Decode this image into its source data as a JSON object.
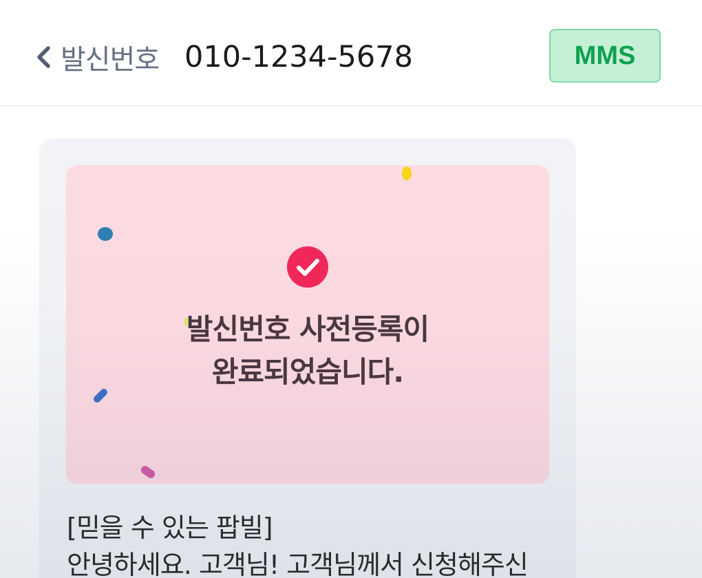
{
  "header": {
    "back_label": "발신번호",
    "phone_number": "010-1234-5678",
    "badge": "MMS"
  },
  "card": {
    "title_line1": "발신번호 사전등록이",
    "title_line2": "완료되었습니다."
  },
  "message": {
    "line1": "[믿을 수 있는 팝빌]",
    "line2": "안녕하세요. 고객님! 고객님께서 신청해주신"
  },
  "colors": {
    "badge_bg": "#c5f0d6",
    "badge_text": "#0fa150",
    "check_circle": "#f0285a",
    "card_bg": "#fddbe2"
  },
  "icons": {
    "back": "chevron-left-icon",
    "check": "check-circle-icon"
  }
}
